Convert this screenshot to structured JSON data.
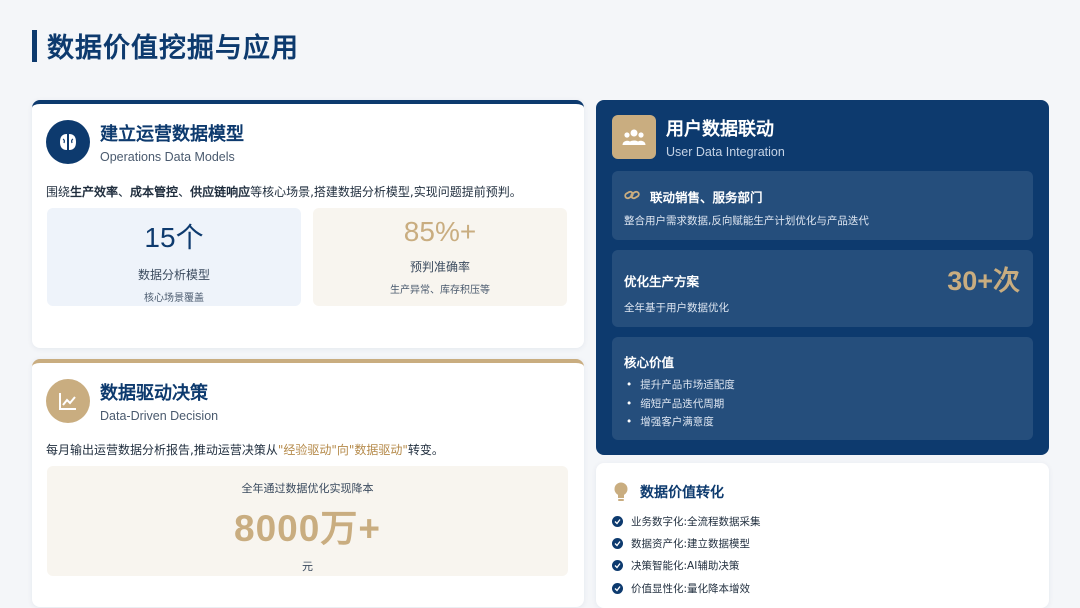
{
  "page": {
    "title": "数据价值挖掘与应用"
  },
  "model_card": {
    "title": "建立运营数据模型",
    "subtitle": "Operations Data Models",
    "desc_prefix": "围绕",
    "desc_bold_1": "生产效率",
    "desc_sep_1": "、",
    "desc_bold_2": "成本管控",
    "desc_sep_2": "、",
    "desc_bold_3": "供应链响应",
    "desc_suffix": "等核心场景,搭建数据分析模型,实现问题提前预判。",
    "stats": [
      {
        "value": "15个",
        "label": "数据分析模型",
        "sub": "核心场景覆盖"
      },
      {
        "value": "85%+",
        "label": "预判准确率",
        "sub": "生产异常、库存积压等"
      }
    ]
  },
  "decision_card": {
    "title": "数据驱动决策",
    "subtitle": "Data-Driven Decision",
    "desc_prefix": "每月输出运营数据分析报告,推动运营决策从",
    "desc_highlight": "\"经验驱动\"向\"数据驱动\"",
    "desc_suffix": "转变。",
    "saving_caption": "全年通过数据优化实现降本",
    "saving_value": "8000万+",
    "saving_unit": "元"
  },
  "user_panel": {
    "title": "用户数据联动",
    "subtitle": "User Data Integration",
    "link_title": "联动销售、服务部门",
    "link_text": "整合用户需求数据,反向赋能生产计划优化与产品迭代",
    "opt_title": "优化生产方案",
    "opt_text": "全年基于用户数据优化",
    "opt_value": "30+次",
    "core_title": "核心价值",
    "core_items": [
      "提升产品市场适配度",
      "缩短产品迭代周期",
      "增强客户满意度"
    ]
  },
  "value_card": {
    "title": "数据价值转化",
    "items": [
      "业务数字化:全流程数据采集",
      "数据资产化:建立数据模型",
      "决策智能化:AI辅助决策",
      "价值显性化:量化降本增效"
    ]
  },
  "colors": {
    "navy": "#0d3a6e",
    "gold": "#c9ad80",
    "background": "#f4f6f9"
  },
  "icons": {
    "model": "brain-icon",
    "decision": "chart-line-icon",
    "users": "users-icon",
    "link": "chain-link-icon",
    "value": "lightbulb-icon",
    "check": "check-circle-icon"
  }
}
